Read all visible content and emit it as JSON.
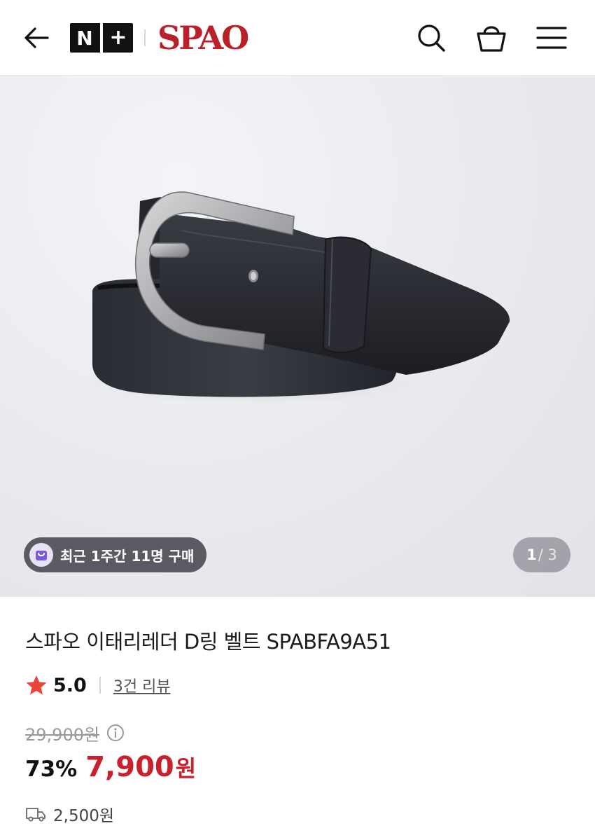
{
  "header": {
    "badge_n": "N",
    "badge_plus": "+",
    "brand": "SPAO"
  },
  "gallery": {
    "purchase_badge": "최근 1주간 11명 구매",
    "page_current": "1",
    "page_total": "/ 3"
  },
  "product": {
    "title": "스파오 이태리레더 D링 벨트 SPABFA9A51",
    "rating": "5.0",
    "review_link": "3건 리뷰",
    "original_price": "29,900원",
    "discount": "73%",
    "sale_price": "7,900",
    "sale_unit": "원",
    "shipping_fee": "2,500원"
  },
  "colors": {
    "brand_red": "#b8202a",
    "sale_red": "#c8202c",
    "star": "#e8443a"
  }
}
